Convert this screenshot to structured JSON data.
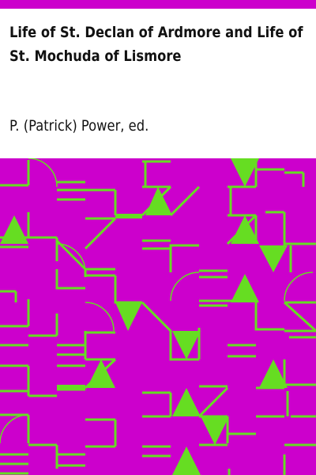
{
  "book": {
    "title": "Life of St. Declan of Ardmore and Life of St. Mochuda of Lismore",
    "author": "P. (Patrick) Power, ed."
  },
  "colors": {
    "accent": "#cc00cc",
    "pattern": "#66dd22",
    "background": "#ffffff",
    "text": "#111111"
  }
}
